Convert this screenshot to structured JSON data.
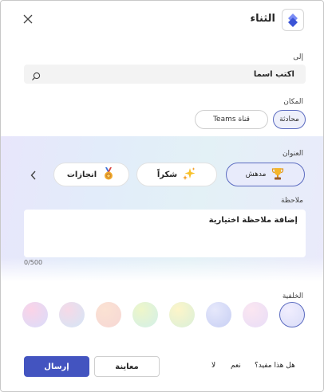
{
  "header": {
    "title": "الثناء",
    "close_icon": "close-icon",
    "app_icon": "praise-app-icon",
    "app_color": "#4f6bed"
  },
  "to": {
    "label": "إلى",
    "placeholder": "اكتب اسما",
    "search_icon": "search-icon"
  },
  "location": {
    "label": "المكان",
    "options": [
      {
        "label": "محادثة",
        "selected": true
      },
      {
        "label": "قناة Teams",
        "selected": false
      }
    ]
  },
  "badges": {
    "label": "العنوان",
    "items": [
      {
        "label": "مدهش",
        "icon": "trophy-icon",
        "selected": true
      },
      {
        "label": "شكراً",
        "icon": "sparkles-icon",
        "selected": false
      },
      {
        "label": "انجازات",
        "icon": "medal-icon",
        "selected": false
      }
    ],
    "next_icon": "chevron-left-icon"
  },
  "note": {
    "label": "ملاحظة",
    "placeholder": "إضافة ملاحظة اختيارية",
    "counter": "0/500"
  },
  "background": {
    "label": "الخلفية",
    "swatches": [
      {
        "name": "lavender",
        "colors": [
          "#f1eefe",
          "#d9ddf8"
        ],
        "selected": true
      },
      {
        "name": "pink-lilac",
        "colors": [
          "#fbe6f1",
          "#e8ddf7"
        ],
        "selected": false
      },
      {
        "name": "periwinkle",
        "colors": [
          "#e6e8fb",
          "#c7cff4"
        ],
        "selected": false
      },
      {
        "name": "yellow-mint",
        "colors": [
          "#fdf5c9",
          "#d9f0d9"
        ],
        "selected": false
      },
      {
        "name": "lime-aqua",
        "colors": [
          "#eef6c9",
          "#d2f0e9"
        ],
        "selected": false
      },
      {
        "name": "peach",
        "colors": [
          "#fbe2d3",
          "#f6d7d4"
        ],
        "selected": false
      },
      {
        "name": "rose-sky",
        "colors": [
          "#f6d9e7",
          "#d3e6f7"
        ],
        "selected": false
      },
      {
        "name": "pink-violet",
        "colors": [
          "#fbd3e7",
          "#d9ddfb"
        ],
        "selected": false
      }
    ]
  },
  "footer": {
    "helpful": "هل هذا مفيد؟",
    "yes": "نعم",
    "no": "لا",
    "preview": "معاينة",
    "send": "إرسال"
  },
  "colors": {
    "accent": "#4354c0"
  }
}
